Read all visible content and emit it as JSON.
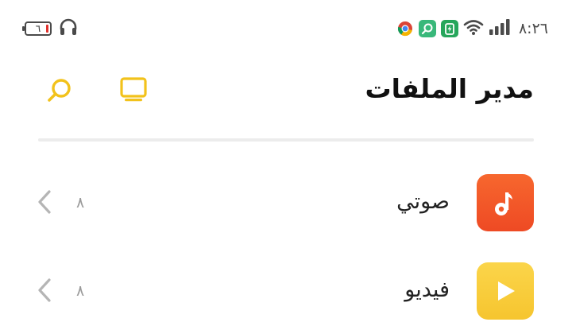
{
  "status_bar": {
    "battery_percent_label": "٦",
    "time": "٨:٢٦",
    "icons": [
      "headphones-icon",
      "chrome-icon",
      "map-app-icon",
      "battery-saver-icon",
      "wifi-icon",
      "signal-icon"
    ]
  },
  "header": {
    "title": "مدير الملفات",
    "icons": [
      "monitor-icon",
      "search-icon"
    ]
  },
  "categories": [
    {
      "label": "صوتي",
      "count": "٨",
      "icon": "music-note-icon",
      "color": "#f25a2b"
    },
    {
      "label": "فيديو",
      "count": "٨",
      "icon": "play-icon",
      "color": "#f9cf3d"
    }
  ],
  "colors": {
    "accent": "#f2c21b",
    "divider": "#ececec"
  }
}
